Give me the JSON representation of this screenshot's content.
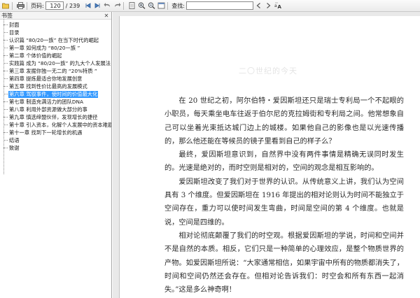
{
  "toolbar": {
    "page_label": "页码:",
    "page_current": "120",
    "page_total": "/ 239",
    "search_label": "查找:",
    "search_value": ""
  },
  "sidebar": {
    "title": "书签",
    "items": [
      "封面",
      "目录",
      "认识篇 “80/20一族” 在当下时代的崛起",
      "第一章 如何成为 “80/20一族 ”",
      "第二章 个体价值的崛起",
      "实践篇 成为 “80/20一族” 的九大个人发展法",
      "第三章 发掘你独一无二的 “20%特质 ”",
      "第四章 提炼最适合你地发展创意",
      "第五章 找到性价比最高的发展模式",
      "第六章 驾驭事件，使时间的价值最大化",
      "第七章 制造充满活力的团队DNA",
      "第八章 利用外部资源做大部分的事",
      "第九章 慎选缔盟伙伴，发现增长的捷径",
      "第十章 引入资本，化解个人发展中的资本难题",
      "第十一章 找到下一轮增长的机遇",
      "结语",
      "致谢"
    ],
    "selected_index": 9
  },
  "document": {
    "faint_header": "二〇世纪的今天",
    "paragraphs": [
      "在 20 世纪之初，阿尔伯特・爱因斯坦还只是瑞士专利局一个不起眼的小职员，每天乘坐电车往返于伯尔尼的克拉姆街和专利局之间。他常想象自己可以坐着光束抵达城门边上的城楼。如果他自己的影像也是以光速传播的，那么他还能在等候员的镜子里看到自己的样子么？",
      "最终，爱因斯坦意识到，自然界中没有两件事情是精确无误同时发生的。光速是绝对的，而时空则是相对的，空间的观念是相互影响的。",
      "爱因斯坦改变了我们对于世界的认识。从传统意义上讲，我们认为空间具有 3 个维度。但爱因斯坦在 1916 年提出的相对论则认为时间不能独立于空间存在，重力可以使时间发生弯曲，时间是空间的第 4 个维度。也就是说，空间是四维的。",
      "相对论彻底颠覆了我们的时空观。根据爱因斯坦的学说，时间和空间并不是自然的本质。相反，它们只是一种简单的心理效应，是整个物质世界的产物。如爱因斯坦所说：“大家通常相信，如果宇宙中所有的物质都消失了，时间和空间仍然还会存在。但相对论告诉我们：时空会和所有东西一起消失。”这是多么神奇啊！"
    ]
  }
}
